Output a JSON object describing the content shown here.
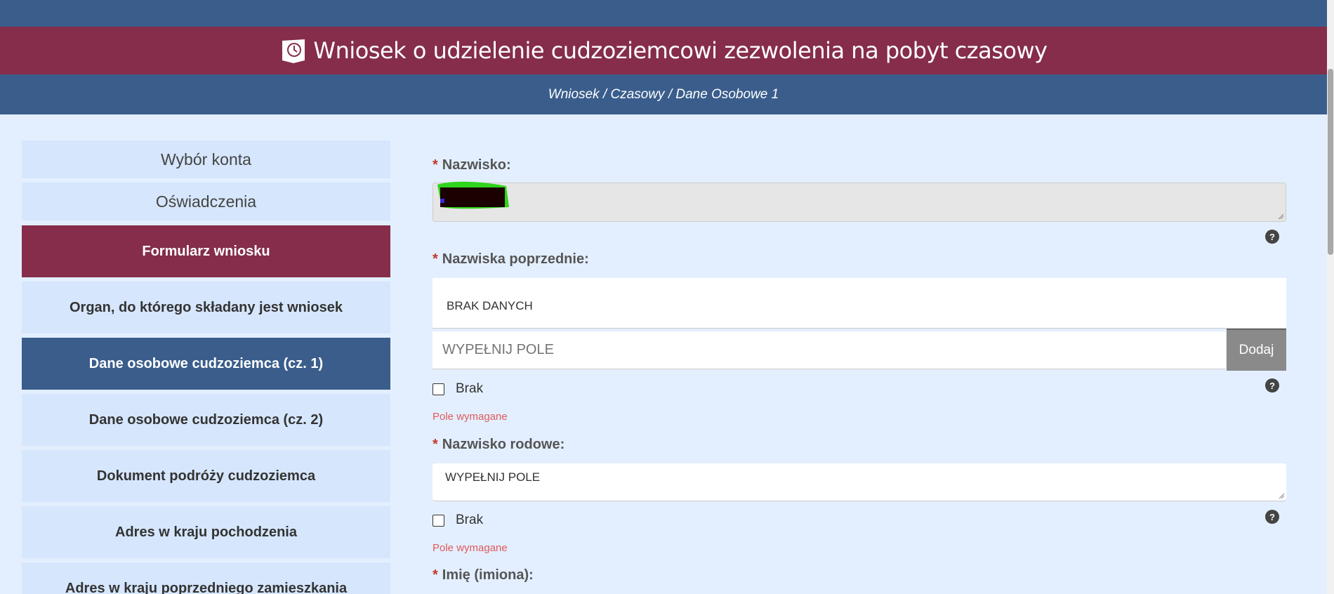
{
  "header": {
    "title": "Wniosek o udzielenie cudzoziemcowi zezwolenia na pobyt czasowy",
    "breadcrumb": "Wniosek / Czasowy / Dane Osobowe 1"
  },
  "sidebar": {
    "items": [
      {
        "label": "Wybór konta"
      },
      {
        "label": "Oświadczenia"
      },
      {
        "label": "Formularz wniosku"
      },
      {
        "label": "Organ, do którego składany jest wniosek"
      },
      {
        "label": "Dane osobowe cudzoziemca (cz. 1)"
      },
      {
        "label": "Dane osobowe cudzoziemca (cz. 2)"
      },
      {
        "label": "Dokument podróży cudzoziemca"
      },
      {
        "label": "Adres w kraju pochodzenia"
      },
      {
        "label": "Adres w kraju poprzedniego zamieszkania"
      }
    ]
  },
  "form": {
    "required_mark": "*",
    "help_glyph": "?",
    "surname": {
      "label": "Nazwisko:"
    },
    "previous_surnames": {
      "label": "Nazwiska poprzednie:",
      "value": "BRAK DANYCH",
      "new_entry_placeholder": "WYPEŁNIJ POLE",
      "add_label": "Dodaj",
      "none_label": "Brak",
      "error": "Pole wymagane"
    },
    "family_name": {
      "label": "Nazwisko rodowe:",
      "value": "WYPEŁNIJ POLE",
      "none_label": "Brak",
      "error": "Pole wymagane"
    },
    "first_names": {
      "label": "Imię (imiona):"
    }
  },
  "colors": {
    "blue": "#3a5d8c",
    "maroon": "#852d4a",
    "background": "#e3efff",
    "error": "#e05a5a"
  }
}
